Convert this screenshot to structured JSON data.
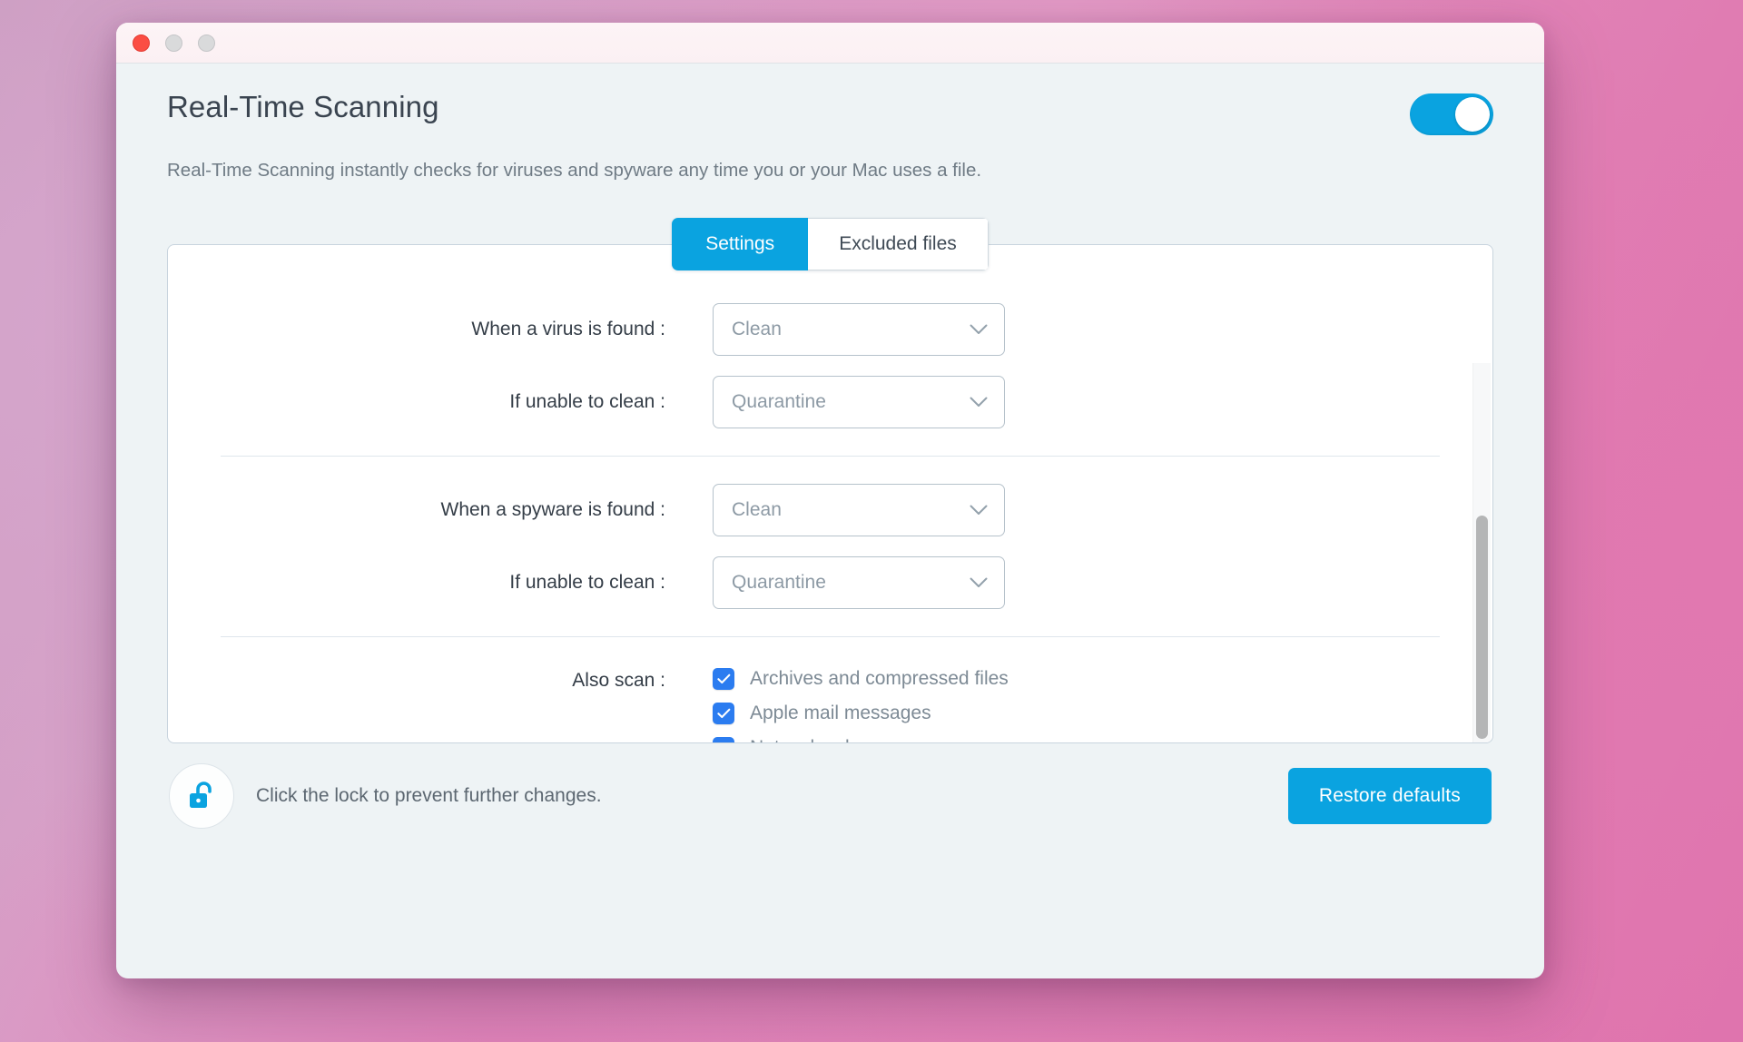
{
  "window": {
    "traffic_lights": [
      {
        "name": "close",
        "color": "#fb4d43"
      },
      {
        "name": "minimize",
        "color": "#d9dadb"
      },
      {
        "name": "zoom",
        "color": "#d9dadb"
      }
    ]
  },
  "header": {
    "title": "Real-Time Scanning",
    "subtitle": "Real-Time Scanning instantly checks for viruses and spyware any time you or your Mac uses a file.",
    "toggle": {
      "state": "on",
      "color": "#0aa3e0"
    }
  },
  "tabs": [
    {
      "label": "Settings",
      "active": true
    },
    {
      "label": "Excluded files",
      "active": false
    }
  ],
  "settings": {
    "virus_section": [
      {
        "label": "When a virus is found :",
        "value": "Clean"
      },
      {
        "label": "If unable to clean :",
        "value": "Quarantine"
      }
    ],
    "spyware_section": [
      {
        "label": "When a spyware is found :",
        "value": "Clean"
      },
      {
        "label": "If unable to clean :",
        "value": "Quarantine"
      }
    ],
    "also_scan": {
      "label": "Also scan :",
      "items": [
        {
          "label": "Archives and compressed files",
          "checked": true
        },
        {
          "label": "Apple mail messages",
          "checked": true
        },
        {
          "label": "Network volumes",
          "checked": true
        }
      ]
    }
  },
  "footer": {
    "lock_state": "unlocked",
    "lock_text": "Click the lock to prevent further changes.",
    "restore_label": "Restore defaults"
  },
  "colors": {
    "accent": "#0aa3e0",
    "checkbox": "#2b7cf0",
    "panel_border": "#c8d4de",
    "text_primary": "#343d47",
    "text_muted": "#8d9aa5"
  }
}
